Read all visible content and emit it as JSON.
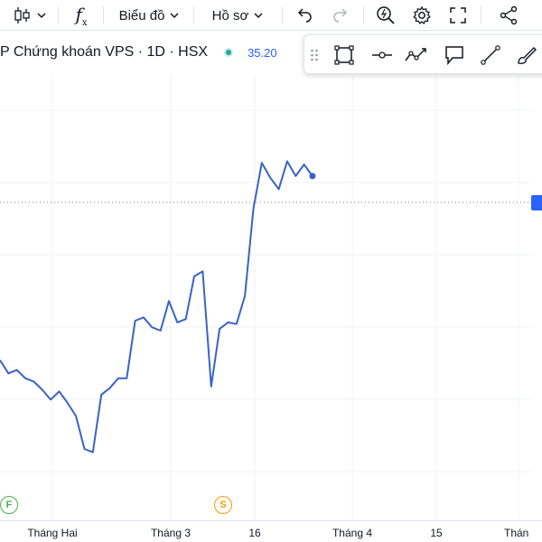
{
  "toolbar": {
    "chart_menu_label": "Biểu đồ",
    "profile_menu_label": "Hồ sơ",
    "fx_label": "f"
  },
  "legend": {
    "title": "P Chứng khoán VPS · 1D · HSX",
    "price": "35.20"
  },
  "time_axis": {
    "labels": [
      "Tháng Hai",
      "Tháng 3",
      "16",
      "Tháng 4",
      "15",
      "Thán"
    ]
  },
  "events": {
    "financial_label": "F",
    "dividend_label": "S"
  },
  "colors": {
    "line": "#3a62c5",
    "price_tag": "#2962ff",
    "status_dot": "#26a69a",
    "event_financial": "#4caf50",
    "event_dividend": "#ff9800"
  },
  "chart_data": {
    "type": "line",
    "series": [
      {
        "values": [
          25.6,
          24.8,
          25.0,
          24.5,
          24.3,
          23.8,
          23.2,
          23.7,
          23.0,
          22.2,
          20.2,
          20.0,
          23.5,
          23.9,
          24.5,
          24.5,
          28.0,
          28.2,
          27.6,
          27.4,
          29.2,
          27.9,
          28.1,
          30.7,
          31.0,
          24.0,
          27.5,
          27.9,
          27.8,
          29.5,
          34.8,
          37.6,
          36.7,
          36.0,
          37.7,
          36.8,
          37.5,
          36.8
        ]
      }
    ],
    "x_axis_ticks": [
      "Tháng Hai",
      "Tháng 3",
      "16",
      "Tháng 4",
      "15",
      "Thán"
    ],
    "last_value": 35.2,
    "grid": true
  }
}
